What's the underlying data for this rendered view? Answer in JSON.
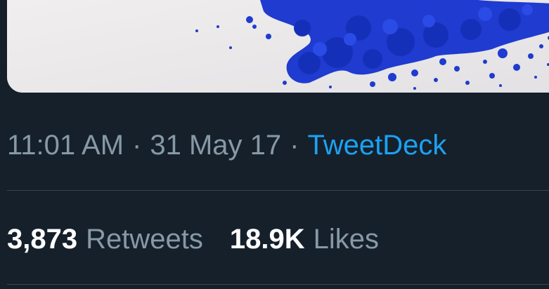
{
  "tweet": {
    "media": {
      "description_icon": "media-image"
    },
    "meta": {
      "time": "11:01 AM",
      "separator_1": "·",
      "date": "31 May 17",
      "separator_2": "·",
      "source": "TweetDeck"
    },
    "stats": {
      "retweets_count": "3,873",
      "retweets_label": "Retweets",
      "likes_count": "18.9K",
      "likes_label": "Likes"
    }
  },
  "colors": {
    "background": "#15202b",
    "muted_text": "#8899a6",
    "link": "#1da1f2",
    "primary_text": "#ffffff",
    "divider": "#38444d",
    "pigment": "#1f3bd0"
  }
}
